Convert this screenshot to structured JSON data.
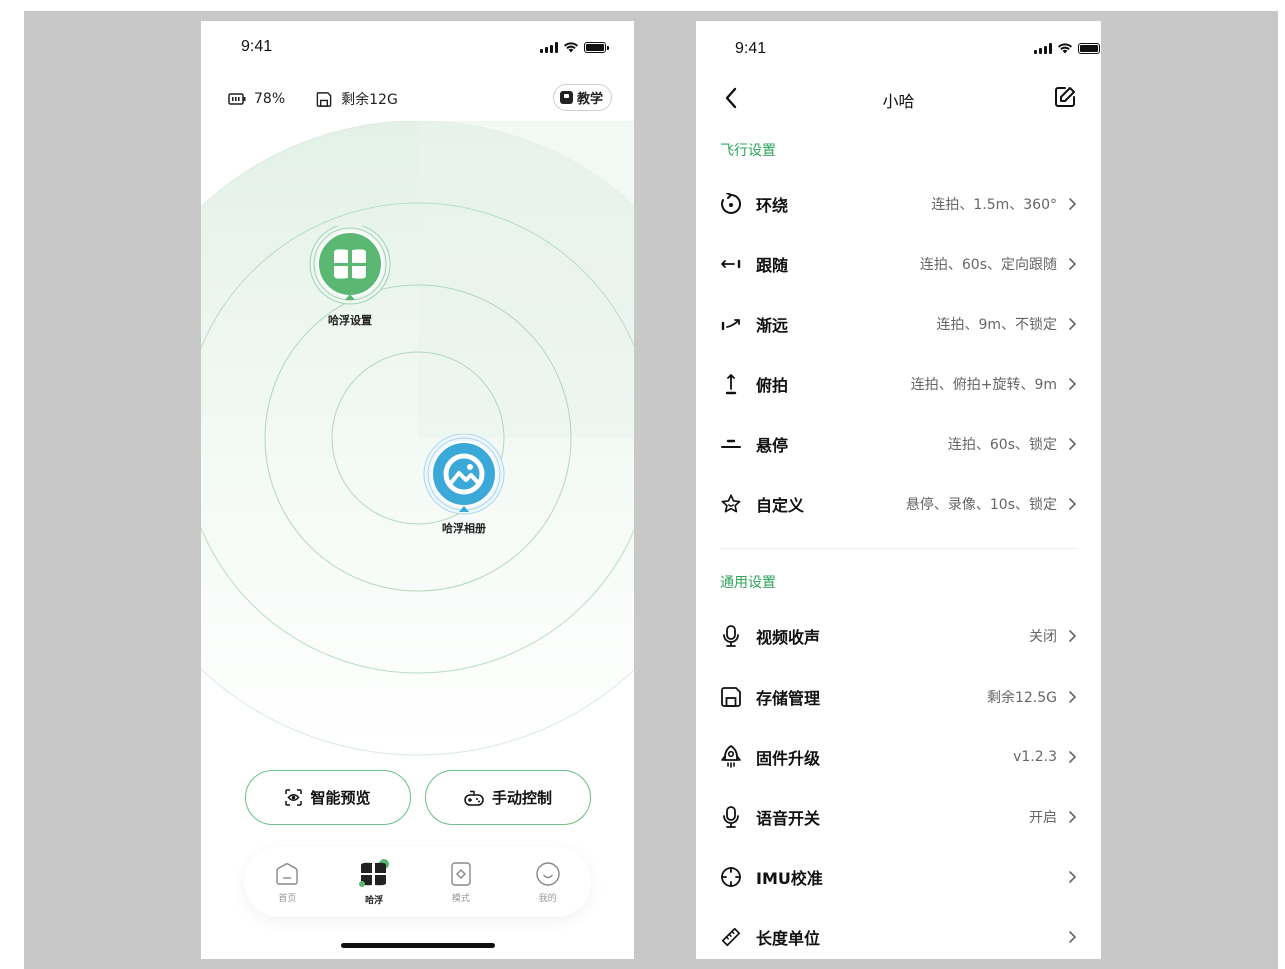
{
  "left": {
    "status_time": "9:41",
    "battery_pct": "78%",
    "storage": "剩余12G",
    "teach_label": "教学",
    "nodes": {
      "settings_label": "哈浮设置",
      "album_label": "哈浮相册"
    },
    "buttons": {
      "preview": "智能预览",
      "manual": "手动控制"
    },
    "tabs": [
      {
        "label": "首页"
      },
      {
        "label": "哈浮"
      },
      {
        "label": "模式"
      },
      {
        "label": "我的"
      }
    ],
    "colors": {
      "accent": "#2fa45a",
      "album_blue": "#3aa9d8",
      "settings_green": "#5ab872"
    }
  },
  "right": {
    "status_time": "9:41",
    "title": "小哈",
    "flight_section": "飞行设置",
    "flight_rows": [
      {
        "name": "环绕",
        "value": "连拍、1.5m、360°",
        "icon": "orbit-icon"
      },
      {
        "name": "跟随",
        "value": "连拍、60s、定向跟随",
        "icon": "follow-icon"
      },
      {
        "name": "渐远",
        "value": "连拍、9m、不锁定",
        "icon": "dronie-icon"
      },
      {
        "name": "俯拍",
        "value": "连拍、俯拍+旋转、9m",
        "icon": "topdown-icon"
      },
      {
        "name": "悬停",
        "value": "连拍、60s、锁定",
        "icon": "hover-icon"
      },
      {
        "name": "自定义",
        "value": "悬停、录像、10s、锁定",
        "icon": "star-icon"
      }
    ],
    "general_section": "通用设置",
    "general_rows": [
      {
        "name": "视频收声",
        "value": "关闭",
        "icon": "mic-icon"
      },
      {
        "name": "存储管理",
        "value": "剩余12.5G",
        "icon": "save-icon"
      },
      {
        "name": "固件升级",
        "value": "v1.2.3",
        "icon": "rocket-icon"
      },
      {
        "name": "语音开关",
        "value": "开启",
        "icon": "mic-icon"
      },
      {
        "name": "IMU校准",
        "value": "",
        "icon": "crosshair-icon"
      },
      {
        "name": "长度单位",
        "value": "",
        "icon": "ruler-icon"
      }
    ]
  }
}
